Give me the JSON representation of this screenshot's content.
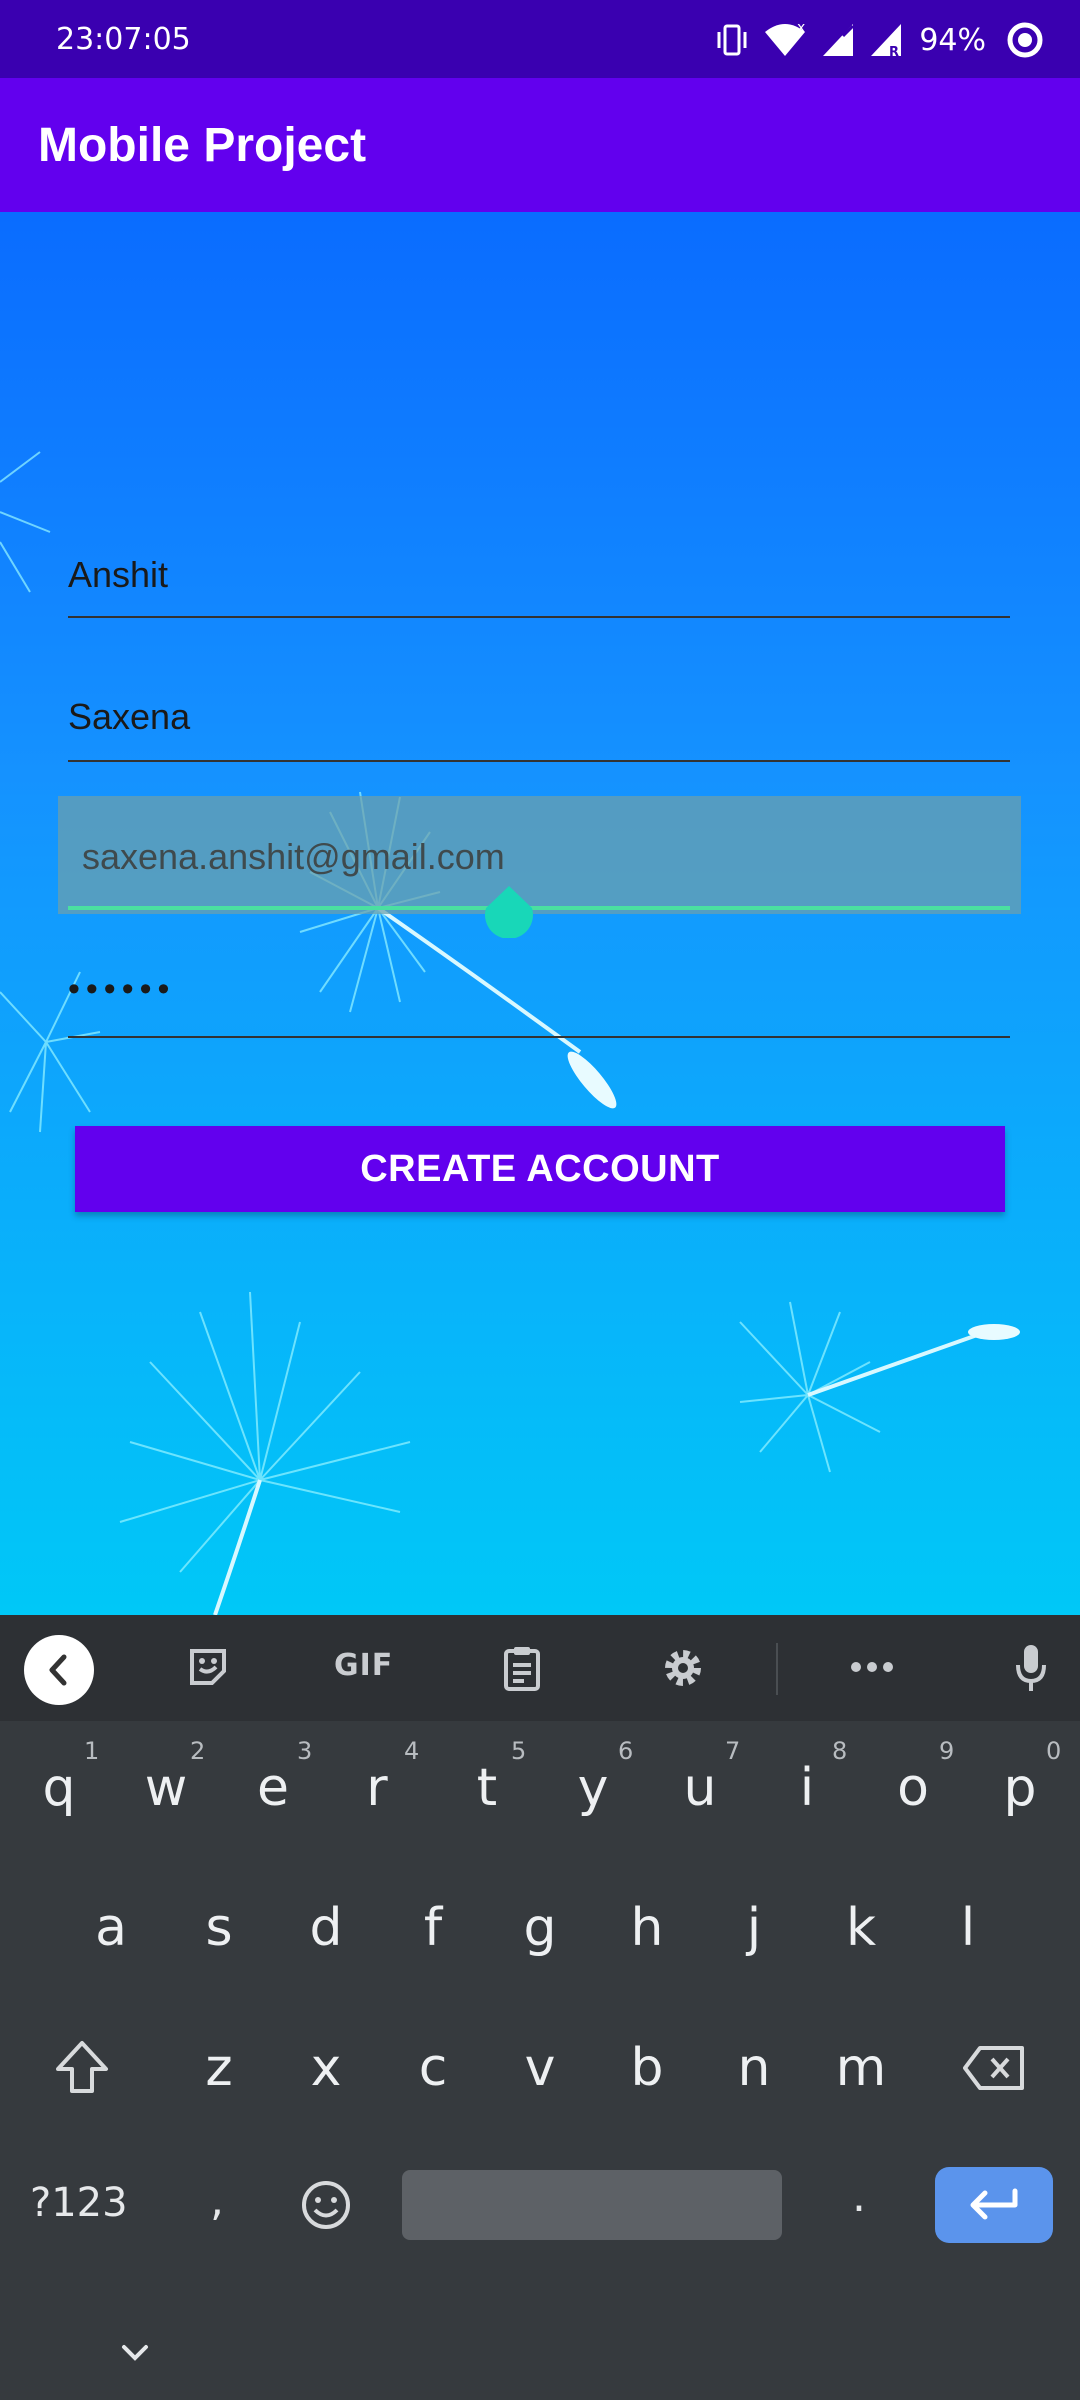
{
  "status_bar": {
    "time": "23:07:05",
    "battery": "94%",
    "icons": [
      "vibrate-icon",
      "wifi-icon",
      "signal-icon",
      "signal-roaming-icon",
      "record-icon"
    ]
  },
  "app_bar": {
    "title": "Mobile Project"
  },
  "form": {
    "first_name": "Anshit",
    "last_name": "Saxena",
    "email": "saxena.anshit@gmail.com",
    "password": "••••••",
    "create_button": "CREATE ACCOUNT"
  },
  "keyboard": {
    "toolbar": {
      "gif": "GIF",
      "icons": [
        "back-icon",
        "sticker-icon",
        "clipboard-icon",
        "settings-icon",
        "more-icon",
        "mic-icon"
      ]
    },
    "row1": [
      "q",
      "w",
      "e",
      "r",
      "t",
      "y",
      "u",
      "i",
      "o",
      "p"
    ],
    "row1_hints": [
      "1",
      "2",
      "3",
      "4",
      "5",
      "6",
      "7",
      "8",
      "9",
      "0"
    ],
    "row2": [
      "a",
      "s",
      "d",
      "f",
      "g",
      "h",
      "j",
      "k",
      "l"
    ],
    "row3": [
      "z",
      "x",
      "c",
      "v",
      "b",
      "n",
      "m"
    ],
    "symbols_key": "?123",
    "comma_key": ",",
    "period_key": "."
  },
  "colors": {
    "status_bar": "#3a00b0",
    "app_bar": "#6200ee",
    "button": "#6200ee",
    "focus_line": "#4ae0a0",
    "enter_key": "#5b94ec"
  }
}
